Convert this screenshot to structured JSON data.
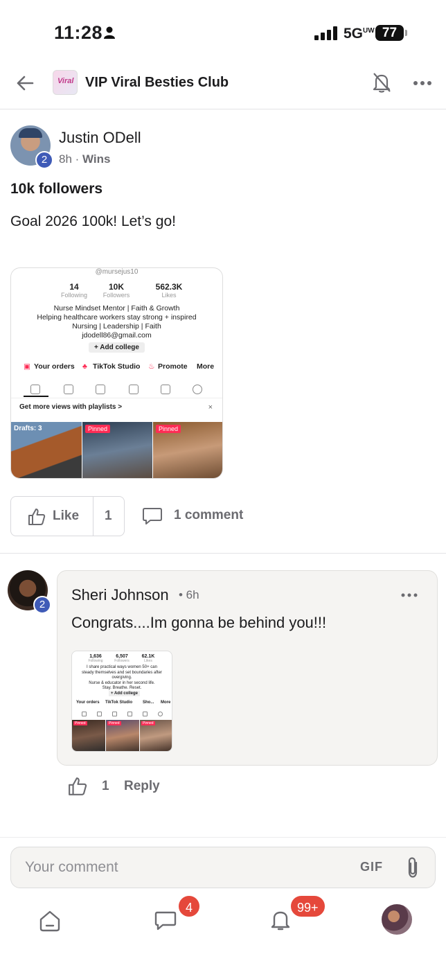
{
  "status_bar": {
    "time": "11:28",
    "network": "5G",
    "network_sup": "UW",
    "battery": "77"
  },
  "header": {
    "group_name": "VIP Viral Besties Club",
    "logo_text": "Viral"
  },
  "post": {
    "author": "Justin ODell",
    "level": "2",
    "time": "8h",
    "category": "Wins",
    "title": "10k followers",
    "body": "Goal 2026 100k! Let’s go!",
    "image": {
      "handle": "@mursejus10",
      "stats": [
        {
          "value": "14",
          "label": "Following"
        },
        {
          "value": "10K",
          "label": "Followers"
        },
        {
          "value": "562.3K",
          "label": "Likes"
        }
      ],
      "bio": [
        "Nurse Mindset Mentor | Faith & Growth",
        "Helping healthcare workers stay strong + inspired",
        "Nursing | Leadership | Faith",
        "jdodell86@gmail.com"
      ],
      "add_college": "+ Add college",
      "actions": [
        "Your orders",
        "TikTok Studio",
        "Promote",
        "More"
      ],
      "playlists": "Get more views with playlists >",
      "close": "×",
      "drafts": "Drafts: 3",
      "pinned": "Pinned"
    },
    "like_label": "Like",
    "like_count": "1",
    "comment_count": "1 comment"
  },
  "comment": {
    "author": "Sheri Johnson",
    "level": "2",
    "time": "• 6h",
    "text": "Congrats....Im gonna be behind you!!!",
    "image": {
      "stats": [
        {
          "value": "1,636",
          "label": "Following"
        },
        {
          "value": "6,507",
          "label": "Followers"
        },
        {
          "value": "62.1K",
          "label": "Likes"
        }
      ],
      "bio": [
        "I share practical ways women 50+ can",
        "steady themselves and set boundaries after",
        "overgiving.",
        "Nurse & educator in her second life.",
        "Stay. Breathe. Reset."
      ],
      "add_college": "+ Add college",
      "actions": [
        "Your orders",
        "TikTok Studio",
        "Sho...",
        "More"
      ],
      "pinned": "Pinned"
    },
    "like_count": "1",
    "reply_label": "Reply"
  },
  "composer": {
    "placeholder": "Your comment",
    "gif_label": "GIF"
  },
  "tab_bar": {
    "chat_badge": "4",
    "notifications_badge": "99+"
  },
  "colors": {
    "badge_blue": "#3f5bb7",
    "notification_red": "#e5483b",
    "tiktok_pink": "#fe2c55"
  }
}
